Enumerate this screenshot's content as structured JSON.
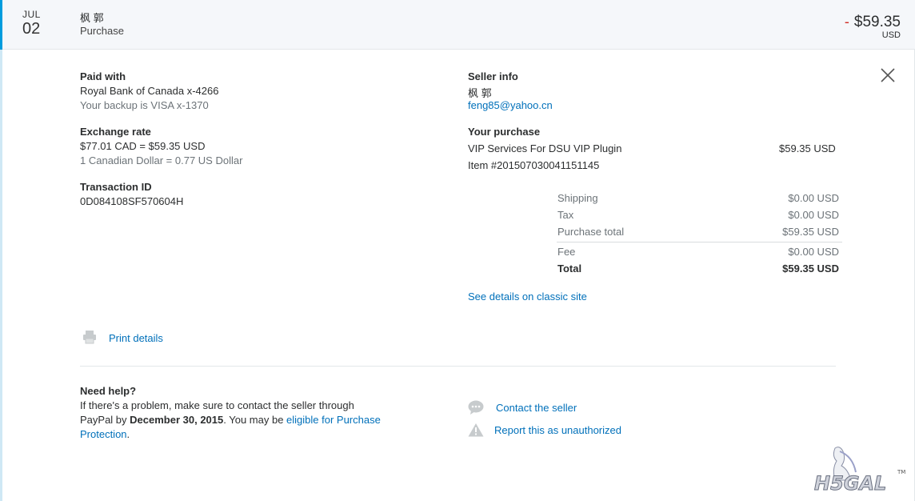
{
  "header": {
    "month": "JUL",
    "day": "02",
    "name": "枫 郭",
    "type": "Purchase",
    "sign": "-",
    "amount": "$59.35",
    "currency": "USD"
  },
  "paid_with": {
    "label": "Paid with",
    "account": "Royal Bank of Canada x-4266",
    "backup": "Your backup is VISA x-1370"
  },
  "exchange": {
    "label": "Exchange rate",
    "conversion": "$77.01 CAD = $59.35 USD",
    "rate": "1 Canadian Dollar = 0.77 US Dollar"
  },
  "transaction": {
    "label": "Transaction ID",
    "id": "0D084108SF570604H"
  },
  "seller": {
    "label": "Seller info",
    "name": "枫 郭",
    "email": "feng85@yahoo.cn"
  },
  "purchase": {
    "label": "Your purchase",
    "item_name": "VIP Services For DSU VIP Plugin",
    "item_price": "$59.35 USD",
    "item_number": "Item #201507030041151145"
  },
  "summary": {
    "shipping_label": "Shipping",
    "shipping_value": "$0.00 USD",
    "tax_label": "Tax",
    "tax_value": "$0.00 USD",
    "purchase_total_label": "Purchase total",
    "purchase_total_value": "$59.35 USD",
    "fee_label": "Fee",
    "fee_value": "$0.00 USD",
    "total_label": "Total",
    "total_value": "$59.35 USD"
  },
  "links": {
    "classic_site": "See details on classic site",
    "print": "Print details",
    "contact_seller": "Contact the seller",
    "report": "Report this as unauthorized"
  },
  "help": {
    "title": "Need help?",
    "line1": "If there's a problem, make sure to contact the seller through",
    "line2_pre": "PayPal by ",
    "line2_date": "December 30, 2015",
    "line2_mid": ". You may be ",
    "line2_link": "eligible for Purchase",
    "line3_link": "Protection",
    "line3_post": "."
  },
  "watermark": {
    "text": "H5GAL",
    "tm": "TM"
  },
  "colors": {
    "accent": "#009cde",
    "link": "#0070ba",
    "negative": "#d03027",
    "muted": "#6c7378"
  }
}
